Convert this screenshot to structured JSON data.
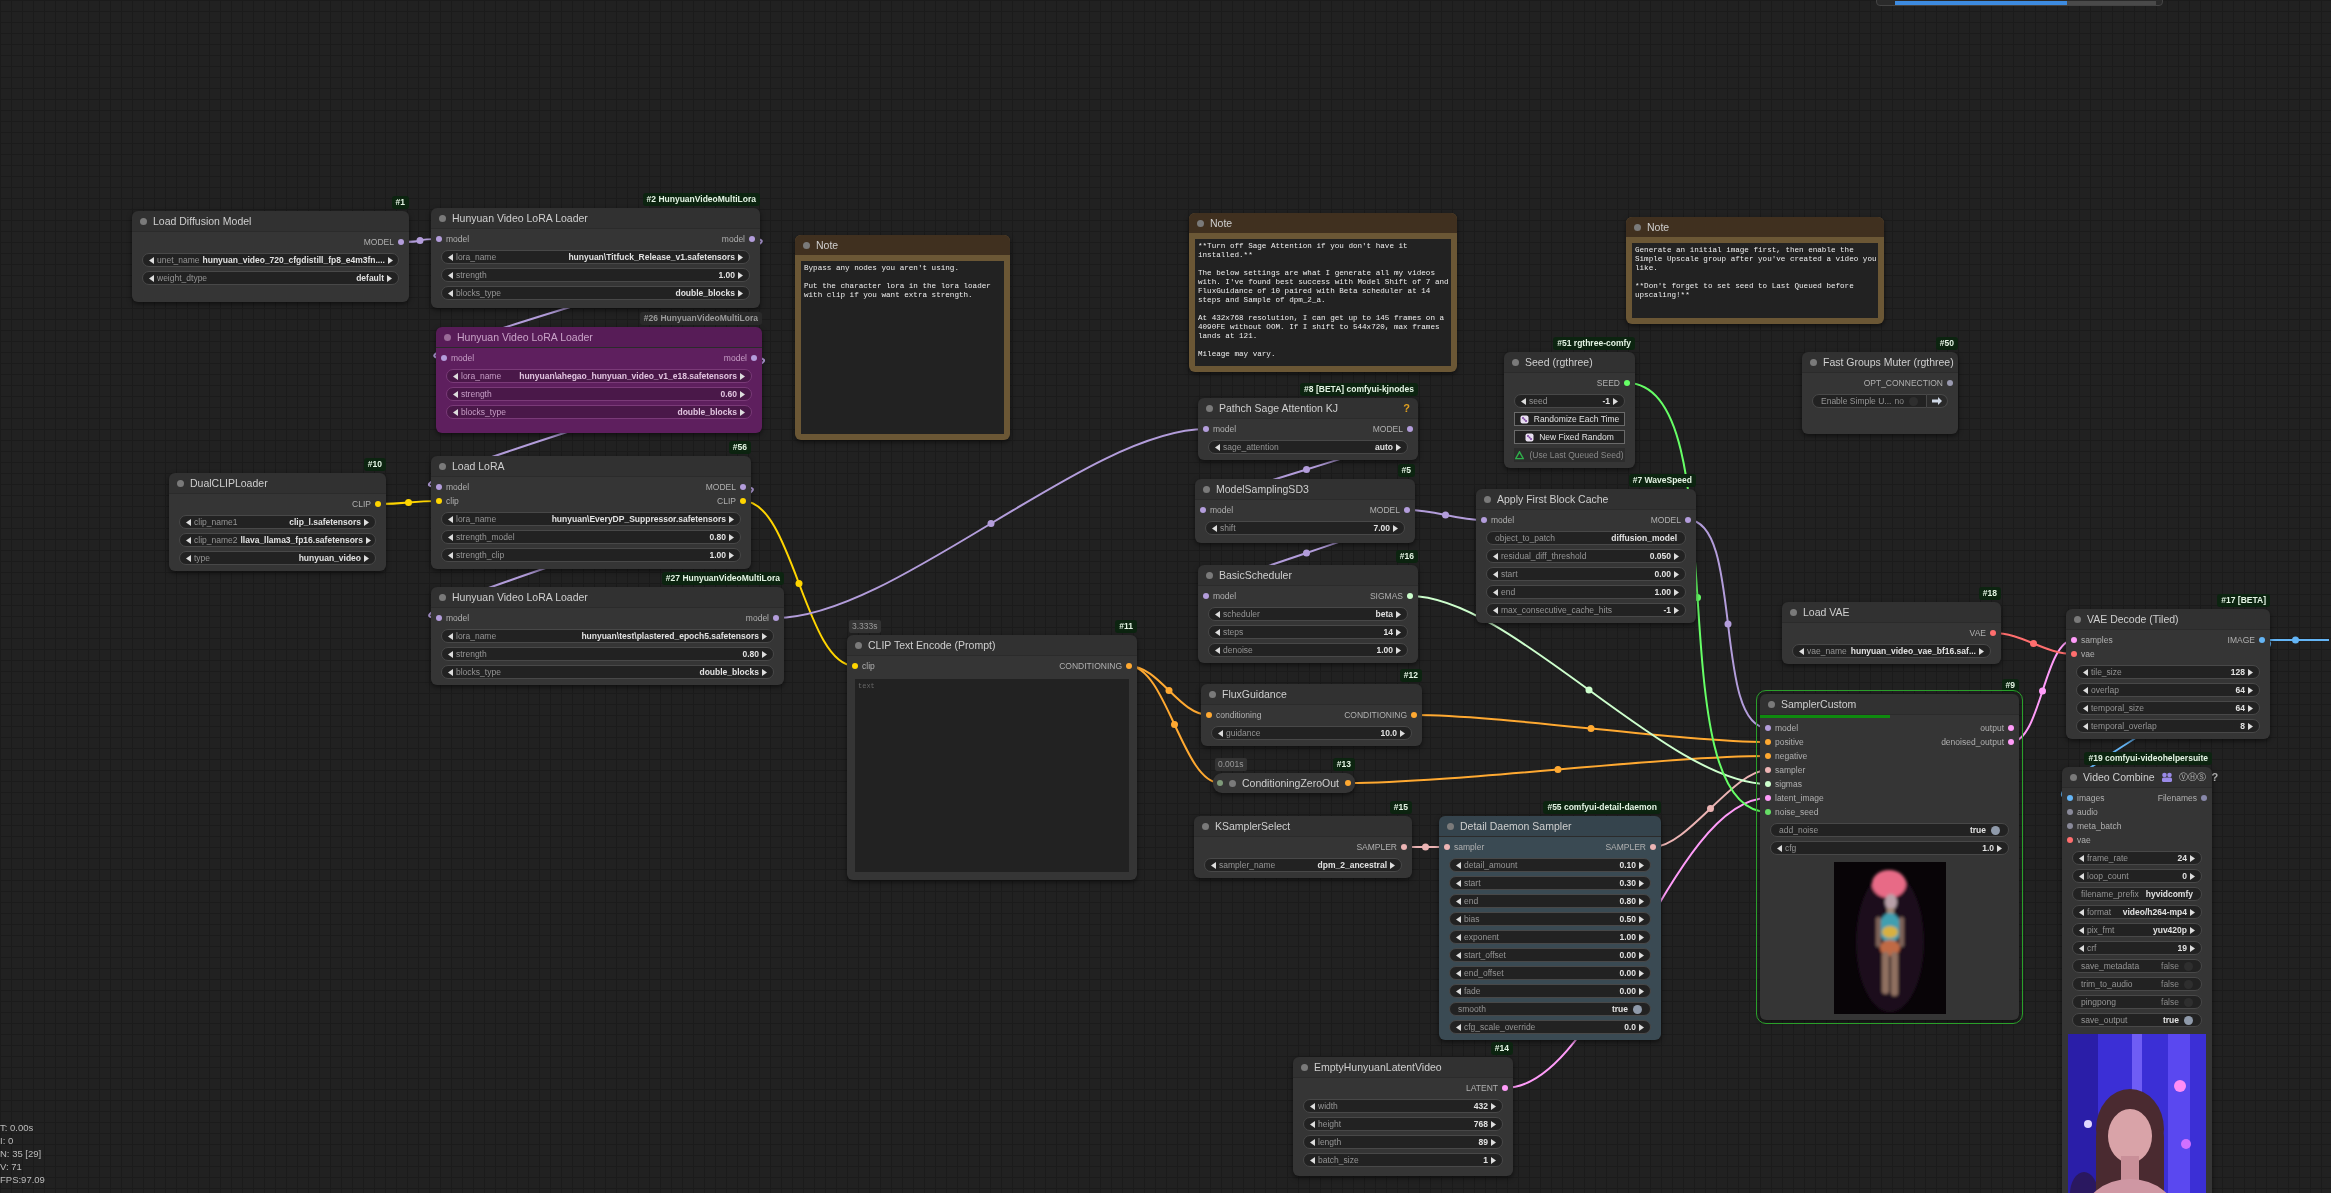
{
  "queue_bar": {
    "level": 0.66
  },
  "nodes": [
    {
      "kind": "node",
      "bypassed": false,
      "executing": false,
      "title": "Load Diffusion Model",
      "badge": "#1",
      "outputs": [
        {
          "label": "MODEL",
          "color": "#b39ddb"
        }
      ],
      "widgets": [
        {
          "kind": "combo",
          "label": "unet_name",
          "value": "hunyuan_video_720_cfgdistill_fp8_e4m3fn...."
        },
        {
          "kind": "combo",
          "label": "weight_dtype",
          "value": "default"
        }
      ]
    },
    {
      "kind": "node",
      "bypassed": false,
      "executing": false,
      "title": "Hunyuan Video LoRA Loader",
      "badge": "#2 HunyuanVideoMultiLora",
      "inputs": [
        {
          "label": "model",
          "color": "#b39ddb"
        }
      ],
      "outputs": [
        {
          "label": "model",
          "color": "#b39ddb"
        }
      ],
      "widgets": [
        {
          "kind": "combo",
          "label": "lora_name",
          "value": "hunyuan\\Titfuck_Release_v1.safetensors"
        },
        {
          "kind": "number",
          "label": "strength",
          "value": "1.00"
        },
        {
          "kind": "combo",
          "label": "blocks_type",
          "value": "double_blocks"
        }
      ]
    },
    {
      "kind": "node",
      "bypassed": true,
      "executing": false,
      "title": "Hunyuan Video LoRA Loader",
      "badge": "#26 HunyuanVideoMultiLora",
      "inputs": [
        {
          "label": "model",
          "color": "#b39ddb"
        }
      ],
      "outputs": [
        {
          "label": "model",
          "color": "#b39ddb"
        }
      ],
      "widgets": [
        {
          "kind": "combo",
          "label": "lora_name",
          "value": "hunyuan\\ahegao_hunyuan_video_v1_e18.safetensors"
        },
        {
          "kind": "number",
          "label": "strength",
          "value": "0.60"
        },
        {
          "kind": "combo",
          "label": "blocks_type",
          "value": "double_blocks"
        }
      ]
    },
    {
      "kind": "note",
      "bypassed": false,
      "executing": false,
      "title": "Note",
      "text": "Bypass any nodes you aren't using.\n\nPut the character lora in the lora loader\nwith clip if you want extra strength."
    },
    {
      "kind": "note",
      "bypassed": false,
      "executing": false,
      "title": "Note",
      "text": "**Turn off Sage Attention if you don't have it\ninstalled.**\n\nThe below settings are what I generate all my videos\nwith. I've found best success with Model Shift of 7 and\nFluxGuidance of 10 paired with Beta scheduler at 14\nsteps and Sample of dpm_2_a.\n\nAt 432x768 resolution, I can get up to 145 frames on a\n4090FE without OOM. If I shift to 544x720, max frames\nlands at 121.\n\nMileage may vary."
    },
    {
      "kind": "note",
      "bypassed": false,
      "executing": false,
      "title": "Note",
      "text": "Generate an initial image first, then enable the\nSimple Upscale group after you've created a video you\nlike.\n\n**Don't forget to set seed to Last Queued before\nupscaling!**"
    },
    {
      "kind": "node",
      "bypassed": false,
      "executing": false,
      "title": "Seed (rgthree)",
      "badge": "#51 rgthree-comfy",
      "outputs": [
        {
          "label": "SEED",
          "color": "#66ff66"
        }
      ],
      "widgets": [
        {
          "kind": "number",
          "label": "seed",
          "value": "-1"
        },
        {
          "kind": "button",
          "label": "Randomize Each Time",
          "disabled": false
        },
        {
          "kind": "button",
          "label": "New Fixed Random",
          "disabled": false
        },
        {
          "kind": "button",
          "label": "(Use Last Queued Seed)",
          "disabled": true
        }
      ]
    },
    {
      "kind": "node",
      "bypassed": false,
      "executing": false,
      "title": "Fast Groups Muter (rgthree)",
      "badge": "#50",
      "outputs": [
        {
          "label": "OPT_CONNECTION",
          "color": "#9a9ab0"
        }
      ],
      "widgets": [
        {
          "kind": "group-toggle",
          "label": "Enable Simple U...",
          "value": "no",
          "on": false
        }
      ]
    },
    {
      "kind": "node",
      "bypassed": false,
      "executing": false,
      "title": "DualCLIPLoader",
      "badge": "#10",
      "outputs": [
        {
          "label": "CLIP",
          "color": "#ffd500"
        }
      ],
      "widgets": [
        {
          "kind": "combo",
          "label": "clip_name1",
          "value": "clip_l.safetensors"
        },
        {
          "kind": "combo",
          "label": "clip_name2",
          "value": "llava_llama3_fp16.safetensors"
        },
        {
          "kind": "combo",
          "label": "type",
          "value": "hunyuan_video"
        }
      ]
    },
    {
      "kind": "node",
      "bypassed": false,
      "executing": false,
      "title": "Load LoRA",
      "badge": "#56",
      "inputs": [
        {
          "label": "model",
          "color": "#b39ddb"
        },
        {
          "label": "clip",
          "color": "#ffd500"
        }
      ],
      "outputs": [
        {
          "label": "MODEL",
          "color": "#b39ddb"
        },
        {
          "label": "CLIP",
          "color": "#ffd500"
        }
      ],
      "widgets": [
        {
          "kind": "combo",
          "label": "lora_name",
          "value": "hunyuan\\EveryDP_Suppressor.safetensors"
        },
        {
          "kind": "number",
          "label": "strength_model",
          "value": "0.80"
        },
        {
          "kind": "number",
          "label": "strength_clip",
          "value": "1.00"
        }
      ]
    },
    {
      "kind": "node",
      "bypassed": false,
      "executing": false,
      "title": "Pathch Sage Attention KJ",
      "badge": "#8 [BETA] comfyui-kjnodes",
      "help": "?",
      "inputs": [
        {
          "label": "model",
          "color": "#b39ddb"
        }
      ],
      "outputs": [
        {
          "label": "MODEL",
          "color": "#b39ddb"
        }
      ],
      "widgets": [
        {
          "kind": "combo",
          "label": "sage_attention",
          "value": "auto"
        }
      ]
    },
    {
      "kind": "node",
      "bypassed": false,
      "executing": false,
      "title": "ModelSamplingSD3",
      "badge": "#5",
      "inputs": [
        {
          "label": "model",
          "color": "#b39ddb"
        }
      ],
      "outputs": [
        {
          "label": "MODEL",
          "color": "#b39ddb"
        }
      ],
      "widgets": [
        {
          "kind": "number",
          "label": "shift",
          "value": "7.00"
        }
      ]
    },
    {
      "kind": "node",
      "bypassed": false,
      "executing": false,
      "title": "Apply First Block Cache",
      "badge": "#7 WaveSpeed",
      "inputs": [
        {
          "label": "model",
          "color": "#b39ddb"
        }
      ],
      "outputs": [
        {
          "label": "MODEL",
          "color": "#b39ddb"
        }
      ],
      "widgets": [
        {
          "kind": "text",
          "label": "object_to_patch",
          "value": "diffusion_model"
        },
        {
          "kind": "number",
          "label": "residual_diff_threshold",
          "value": "0.050"
        },
        {
          "kind": "number",
          "label": "start",
          "value": "0.00"
        },
        {
          "kind": "number",
          "label": "end",
          "value": "1.00"
        },
        {
          "kind": "number",
          "label": "max_consecutive_cache_hits",
          "value": "-1"
        }
      ]
    },
    {
      "kind": "node",
      "bypassed": false,
      "executing": false,
      "title": "BasicScheduler",
      "badge": "#16",
      "inputs": [
        {
          "label": "model",
          "color": "#b39ddb"
        }
      ],
      "outputs": [
        {
          "label": "SIGMAS",
          "color": "#cdffcd"
        }
      ],
      "widgets": [
        {
          "kind": "combo",
          "label": "scheduler",
          "value": "beta"
        },
        {
          "kind": "number",
          "label": "steps",
          "value": "14"
        },
        {
          "kind": "number",
          "label": "denoise",
          "value": "1.00"
        }
      ]
    },
    {
      "kind": "node",
      "bypassed": false,
      "executing": false,
      "title": "Hunyuan Video LoRA Loader",
      "badge": "#27 HunyuanVideoMultiLora",
      "inputs": [
        {
          "label": "model",
          "color": "#b39ddb"
        }
      ],
      "outputs": [
        {
          "label": "model",
          "color": "#b39ddb"
        }
      ],
      "widgets": [
        {
          "kind": "combo",
          "label": "lora_name",
          "value": "hunyuan\\test\\plastered_epoch5.safetensors"
        },
        {
          "kind": "number",
          "label": "strength",
          "value": "0.80"
        },
        {
          "kind": "combo",
          "label": "blocks_type",
          "value": "double_blocks"
        }
      ]
    },
    {
      "kind": "node",
      "bypassed": false,
      "executing": false,
      "title": "Load VAE",
      "badge": "#18",
      "outputs": [
        {
          "label": "VAE",
          "color": "#ff6e6e"
        }
      ],
      "widgets": [
        {
          "kind": "combo",
          "label": "vae_name",
          "value": "hunyuan_video_vae_bf16.saf..."
        }
      ]
    },
    {
      "kind": "node",
      "bypassed": false,
      "executing": false,
      "title": "VAE Decode (Tiled)",
      "badge": "#17 [BETA]",
      "inputs": [
        {
          "label": "samples",
          "color": "#ff9cf9"
        },
        {
          "label": "vae",
          "color": "#ff6e6e"
        }
      ],
      "outputs": [
        {
          "label": "IMAGE",
          "color": "#64b5f6"
        }
      ],
      "widgets": [
        {
          "kind": "number",
          "label": "tile_size",
          "value": "128"
        },
        {
          "kind": "number",
          "label": "overlap",
          "value": "64"
        },
        {
          "kind": "number",
          "label": "temporal_size",
          "value": "64"
        },
        {
          "kind": "number",
          "label": "temporal_overlap",
          "value": "8"
        }
      ]
    },
    {
      "kind": "node",
      "bypassed": false,
      "executing": false,
      "title": "CLIP Text Encode (Prompt)",
      "badge": "#11",
      "timing": "3.333s",
      "inputs": [
        {
          "label": "clip",
          "color": "#ffd500"
        }
      ],
      "outputs": [
        {
          "label": "CONDITIONING",
          "color": "#ffa931"
        }
      ],
      "placeholder": "text"
    },
    {
      "kind": "node",
      "bypassed": false,
      "executing": false,
      "title": "FluxGuidance",
      "badge": "#12",
      "inputs": [
        {
          "label": "conditioning",
          "color": "#ffa931"
        }
      ],
      "outputs": [
        {
          "label": "CONDITIONING",
          "color": "#ffa931"
        }
      ],
      "widgets": [
        {
          "kind": "number",
          "label": "guidance",
          "value": "10.0"
        }
      ]
    },
    {
      "kind": "node",
      "bypassed": false,
      "executing": true,
      "title": "SamplerCustom",
      "badge": "#9",
      "progress": {
        "level": 0.5
      },
      "inputs": [
        {
          "label": "model",
          "color": "#b39ddb"
        },
        {
          "label": "positive",
          "color": "#ffa931"
        },
        {
          "label": "negative",
          "color": "#ffa931"
        },
        {
          "label": "sampler",
          "color": "#ecb4b4"
        },
        {
          "label": "sigmas",
          "color": "#cdffcd"
        },
        {
          "label": "latent_image",
          "color": "#ff9cf9"
        },
        {
          "label": "noise_seed",
          "color": "#66dd66"
        }
      ],
      "outputs": [
        {
          "label": "output",
          "color": "#ff9cf9"
        },
        {
          "label": "denoised_output",
          "color": "#ff9cf9"
        }
      ],
      "widgets": [
        {
          "kind": "toggle",
          "label": "add_noise",
          "value": "true",
          "on": true
        },
        {
          "kind": "number",
          "label": "cfg",
          "value": "1.0"
        }
      ],
      "preview": {
        "kind": "picture"
      }
    },
    {
      "kind": "collapsed",
      "bypassed": false,
      "executing": false,
      "title": "ConditioningZeroOut",
      "badge": "#13",
      "timing": "0.001s",
      "inputs": [
        {
          "color": "#7f9a7a"
        }
      ],
      "outputs": [
        {
          "color": "#ffa931"
        }
      ]
    },
    {
      "kind": "node",
      "bypassed": false,
      "executing": false,
      "title": "Video Combine",
      "title_icons": "ⓋⒽⓈ",
      "help": "?",
      "badge": "#19 comfyui-videohelpersuite",
      "inputs": [
        {
          "label": "images",
          "color": "#64b5f6"
        },
        {
          "label": "audio",
          "color": "#8a8a9a"
        },
        {
          "label": "meta_batch",
          "color": "#8a8a9a"
        },
        {
          "label": "vae",
          "color": "#ff6e6e"
        }
      ],
      "outputs": [
        {
          "label": "Filenames",
          "color": "#8888aa"
        }
      ],
      "widgets": [
        {
          "kind": "number",
          "label": "frame_rate",
          "value": "24"
        },
        {
          "kind": "number",
          "label": "loop_count",
          "value": "0"
        },
        {
          "kind": "text",
          "label": "filename_prefix",
          "value": "hyvidcomfy"
        },
        {
          "kind": "combo",
          "label": "format",
          "value": "video/h264-mp4"
        },
        {
          "kind": "combo",
          "label": "pix_fmt",
          "value": "yuv420p"
        },
        {
          "kind": "number",
          "label": "crf",
          "value": "19"
        },
        {
          "kind": "toggle",
          "label": "save_metadata",
          "value": "false",
          "on": false
        },
        {
          "kind": "toggle",
          "label": "trim_to_audio",
          "value": "false",
          "on": false
        },
        {
          "kind": "toggle",
          "label": "pingpong",
          "value": "false",
          "on": false
        },
        {
          "kind": "toggle",
          "label": "save_output",
          "value": "true",
          "on": true
        }
      ],
      "preview": {
        "kind": "picture"
      }
    },
    {
      "kind": "node",
      "bypassed": false,
      "executing": false,
      "title": "KSamplerSelect",
      "badge": "#15",
      "outputs": [
        {
          "label": "SAMPLER",
          "color": "#ecb4b4"
        }
      ],
      "widgets": [
        {
          "kind": "combo",
          "label": "sampler_name",
          "value": "dpm_2_ancestral"
        }
      ]
    },
    {
      "kind": "node",
      "bypassed": false,
      "executing": false,
      "title": "Detail Daemon Sampler",
      "badge": "#55 comfyui-detail-daemon",
      "color": "#3a4a53",
      "inputs": [
        {
          "label": "sampler",
          "color": "#ecb4b4"
        }
      ],
      "outputs": [
        {
          "label": "SAMPLER",
          "color": "#ecb4b4"
        }
      ],
      "widgets": [
        {
          "kind": "number",
          "label": "detail_amount",
          "value": "0.10"
        },
        {
          "kind": "number",
          "label": "start",
          "value": "0.30"
        },
        {
          "kind": "number",
          "label": "end",
          "value": "0.80"
        },
        {
          "kind": "number",
          "label": "bias",
          "value": "0.50"
        },
        {
          "kind": "number",
          "label": "exponent",
          "value": "1.00"
        },
        {
          "kind": "number",
          "label": "start_offset",
          "value": "0.00"
        },
        {
          "kind": "number",
          "label": "end_offset",
          "value": "0.00"
        },
        {
          "kind": "number",
          "label": "fade",
          "value": "0.00"
        },
        {
          "kind": "toggle",
          "label": "smooth",
          "value": "true",
          "on": true
        },
        {
          "kind": "number",
          "label": "cfg_scale_override",
          "value": "0.0"
        }
      ]
    },
    {
      "kind": "node",
      "bypassed": false,
      "executing": false,
      "title": "EmptyHunyuanLatentVideo",
      "badge": "#14",
      "outputs": [
        {
          "label": "LATENT",
          "color": "#ff9cf9"
        }
      ],
      "widgets": [
        {
          "kind": "number",
          "label": "width",
          "value": "432"
        },
        {
          "kind": "number",
          "label": "height",
          "value": "768"
        },
        {
          "kind": "number",
          "label": "length",
          "value": "89"
        },
        {
          "kind": "number",
          "label": "batch_size",
          "value": "1"
        }
      ]
    }
  ],
  "stats": [
    "T: 0.00s",
    "I: 0",
    "N: 35 [29]",
    "V: 71",
    "FPS:97.09"
  ]
}
